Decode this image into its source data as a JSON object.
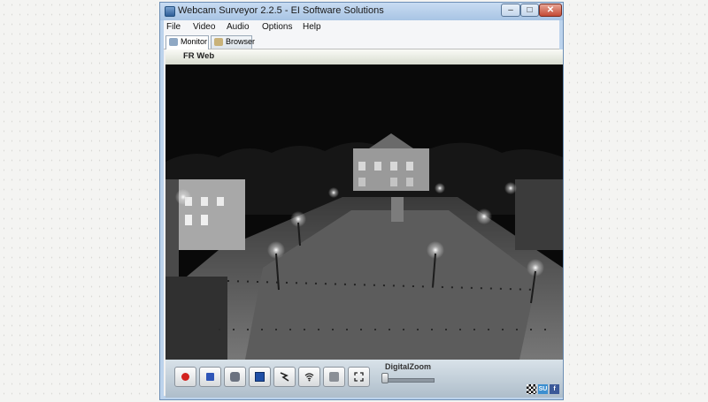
{
  "window": {
    "title": "Webcam Surveyor 2.2.5 - EI Software Solutions",
    "min_label": "–",
    "max_label": "□",
    "close_label": "✕"
  },
  "menu": {
    "items": [
      "File",
      "Video",
      "Audio",
      "Options",
      "Help"
    ]
  },
  "tabs": [
    {
      "label": "Monitor",
      "active": true
    },
    {
      "label": "Browser",
      "active": false
    }
  ],
  "camera": {
    "name": "FR Web"
  },
  "controls": {
    "buttons": [
      "record-icon",
      "stop-icon",
      "snapshot-icon",
      "video-source-icon",
      "motion-detect-icon",
      "broadcast-icon",
      "schedule-icon",
      "fullscreen-icon"
    ],
    "digital_zoom_label": "DigitalZoom",
    "digital_zoom_level": 0
  },
  "social": {
    "items": [
      "checkered-icon",
      "stumbleupon-icon",
      "facebook-icon"
    ],
    "su_label": "SU",
    "fb_label": "f"
  }
}
